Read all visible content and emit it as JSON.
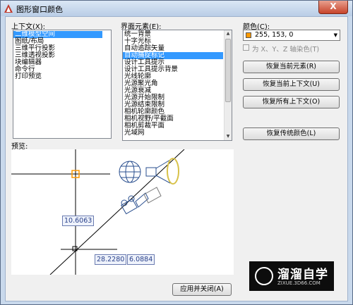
{
  "window": {
    "title": "图形窗口颜色",
    "close_glyph": "X"
  },
  "context": {
    "label": "上下文(X):",
    "items": [
      "二维模型空间",
      "图纸/布局",
      "三维平行投影",
      "三维透视投影",
      "块编辑器",
      "命令行",
      "打印预览"
    ],
    "selected_index": 0
  },
  "elements": {
    "label": "界面元素(E):",
    "items": [
      "统一背景",
      "十字光标",
      "自动追踪矢量",
      "自动捕捉标记",
      "设计工具提示",
      "设计工具提示背景",
      "光线轮廓",
      "光源聚光角",
      "光源衰减",
      "光源开始限制",
      "光源结束限制",
      "相机轮廓颜色",
      "相机视野/平截面",
      "相机剪裁平面",
      "光域网"
    ],
    "selected_index": 3
  },
  "color": {
    "label": "颜色(C):",
    "value": "255, 153, 0",
    "swatch": "#ff9900",
    "tint_label": "为 X、Y、Z 轴染色(T)"
  },
  "buttons": {
    "restore_element": "恢复当前元素(R)",
    "restore_context": "恢复当前上下文(U)",
    "restore_all": "恢复所有上下文(O)",
    "restore_classic": "恢复传统颜色(L)",
    "apply_close": "应用并关闭(A)"
  },
  "preview": {
    "label": "预览:",
    "dim1": "10.6063",
    "dim2": "28.2280",
    "dim3": "6.0884"
  },
  "watermark": {
    "title": "溜溜自学",
    "sub": "ZIXUE.3D66.COM"
  }
}
